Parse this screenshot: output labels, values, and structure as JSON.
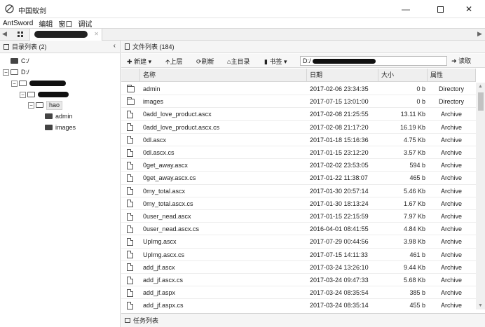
{
  "window": {
    "title": "中国蚁剑",
    "min_icon": "minimize-icon",
    "max_icon": "maximize-icon",
    "close_icon": "close-icon"
  },
  "menu": [
    "AntSword",
    "编辑",
    "窗口",
    "调试"
  ],
  "tabs": {
    "home_icon": "grid-icon",
    "active_label_redacted": true
  },
  "left_panel": {
    "title": "目录列表 (2)",
    "tree": [
      {
        "label": "C:/",
        "depth": 0,
        "expanded": false
      },
      {
        "label": "D:/",
        "depth": 0,
        "expanded": true
      },
      {
        "label": "",
        "depth": 1,
        "redacted": true
      },
      {
        "label": "",
        "depth": 2,
        "redacted": true
      },
      {
        "label": "hao",
        "depth": 3,
        "selected": true
      },
      {
        "label": "admin",
        "depth": 4
      },
      {
        "label": "images",
        "depth": 4
      }
    ]
  },
  "right_panel": {
    "title": "文件列表 (184)",
    "toolbar": {
      "new": "新建",
      "up": "上层",
      "refresh": "刷新",
      "home": "主目录",
      "bookmark": "书签",
      "path": "D:/",
      "read": "读取"
    },
    "columns": [
      "名称",
      "日期",
      "大小",
      "属性"
    ],
    "files": [
      {
        "name": "admin",
        "date": "2017-02-06 23:34:35",
        "size": "0 b",
        "attr": "Directory",
        "type": "dir"
      },
      {
        "name": "images",
        "date": "2017-07-15 13:01:00",
        "size": "0 b",
        "attr": "Directory",
        "type": "dir"
      },
      {
        "name": "0add_love_product.ascx",
        "date": "2017-02-08 21:25:55",
        "size": "13.11 Kb",
        "attr": "Archive",
        "type": "file"
      },
      {
        "name": "0add_love_product.ascx.cs",
        "date": "2017-02-08 21:17:20",
        "size": "16.19 Kb",
        "attr": "Archive",
        "type": "file"
      },
      {
        "name": "0dl.ascx",
        "date": "2017-01-18 15:16:36",
        "size": "4.75 Kb",
        "attr": "Archive",
        "type": "file"
      },
      {
        "name": "0dl.ascx.cs",
        "date": "2017-01-15 23:12:20",
        "size": "3.57 Kb",
        "attr": "Archive",
        "type": "file"
      },
      {
        "name": "0get_away.ascx",
        "date": "2017-02-02 23:53:05",
        "size": "594 b",
        "attr": "Archive",
        "type": "file"
      },
      {
        "name": "0get_away.ascx.cs",
        "date": "2017-01-22 11:38:07",
        "size": "465 b",
        "attr": "Archive",
        "type": "file"
      },
      {
        "name": "0my_total.ascx",
        "date": "2017-01-30 20:57:14",
        "size": "5.46 Kb",
        "attr": "Archive",
        "type": "file"
      },
      {
        "name": "0my_total.ascx.cs",
        "date": "2017-01-30 18:13:24",
        "size": "1.67 Kb",
        "attr": "Archive",
        "type": "file"
      },
      {
        "name": "0user_nead.ascx",
        "date": "2017-01-15 22:15:59",
        "size": "7.97 Kb",
        "attr": "Archive",
        "type": "file"
      },
      {
        "name": "0user_nead.ascx.cs",
        "date": "2016-04-01 08:41:55",
        "size": "4.84 Kb",
        "attr": "Archive",
        "type": "file"
      },
      {
        "name": "UpImg.ascx",
        "date": "2017-07-29 00:44:56",
        "size": "3.98 Kb",
        "attr": "Archive",
        "type": "file"
      },
      {
        "name": "UpImg.ascx.cs",
        "date": "2017-07-15 14:11:33",
        "size": "461 b",
        "attr": "Archive",
        "type": "file"
      },
      {
        "name": "add_jf.ascx",
        "date": "2017-03-24 13:26:10",
        "size": "9.44 Kb",
        "attr": "Archive",
        "type": "file"
      },
      {
        "name": "add_jf.ascx.cs",
        "date": "2017-03-24 09:47:33",
        "size": "5.68 Kb",
        "attr": "Archive",
        "type": "file"
      },
      {
        "name": "add_jf.aspx",
        "date": "2017-03-24 08:35:54",
        "size": "385 b",
        "attr": "Archive",
        "type": "file"
      },
      {
        "name": "add_jf.aspx.cs",
        "date": "2017-03-24 08:35:14",
        "size": "455 b",
        "attr": "Archive",
        "type": "file"
      }
    ]
  },
  "taskbar": {
    "title": "任务列表"
  }
}
